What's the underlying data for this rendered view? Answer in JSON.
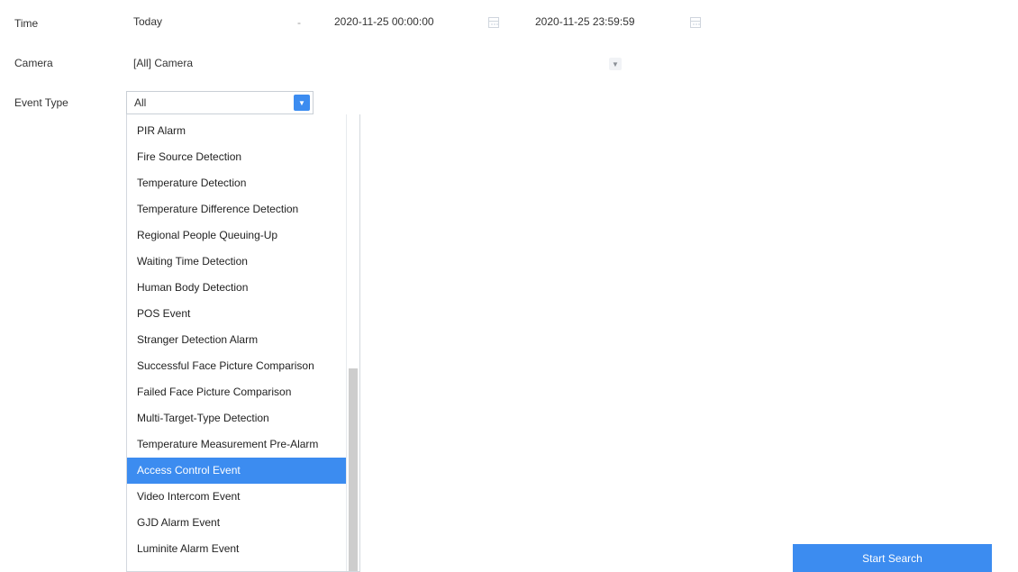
{
  "filters": {
    "time": {
      "label": "Time",
      "range": "Today",
      "separator": "-",
      "start": "2020-11-25 00:00:00",
      "end": "2020-11-25 23:59:59"
    },
    "camera": {
      "label": "Camera",
      "value": "[All] Camera"
    },
    "event_type": {
      "label": "Event Type",
      "value": "All",
      "options": [
        "PIR Alarm",
        "Fire Source Detection",
        "Temperature Detection",
        "Temperature Difference Detection",
        "Regional People Queuing-Up",
        "Waiting Time Detection",
        "Human Body Detection",
        "POS Event",
        "Stranger Detection Alarm",
        "Successful Face Picture Comparison",
        "Failed Face Picture Comparison",
        "Multi-Target-Type Detection",
        "Temperature Measurement Pre-Alarm",
        "Access Control Event",
        "Video Intercom Event",
        "GJD Alarm Event",
        "Luminite Alarm Event"
      ],
      "highlighted": "Access Control Event"
    }
  },
  "actions": {
    "start_search": "Start Search"
  },
  "colors": {
    "accent": "#3c8cf0",
    "text": "#333333",
    "border": "#c9cfd6"
  },
  "icons": {
    "calendar": "calendar-icon",
    "dropdown": "chevron-down-icon"
  }
}
